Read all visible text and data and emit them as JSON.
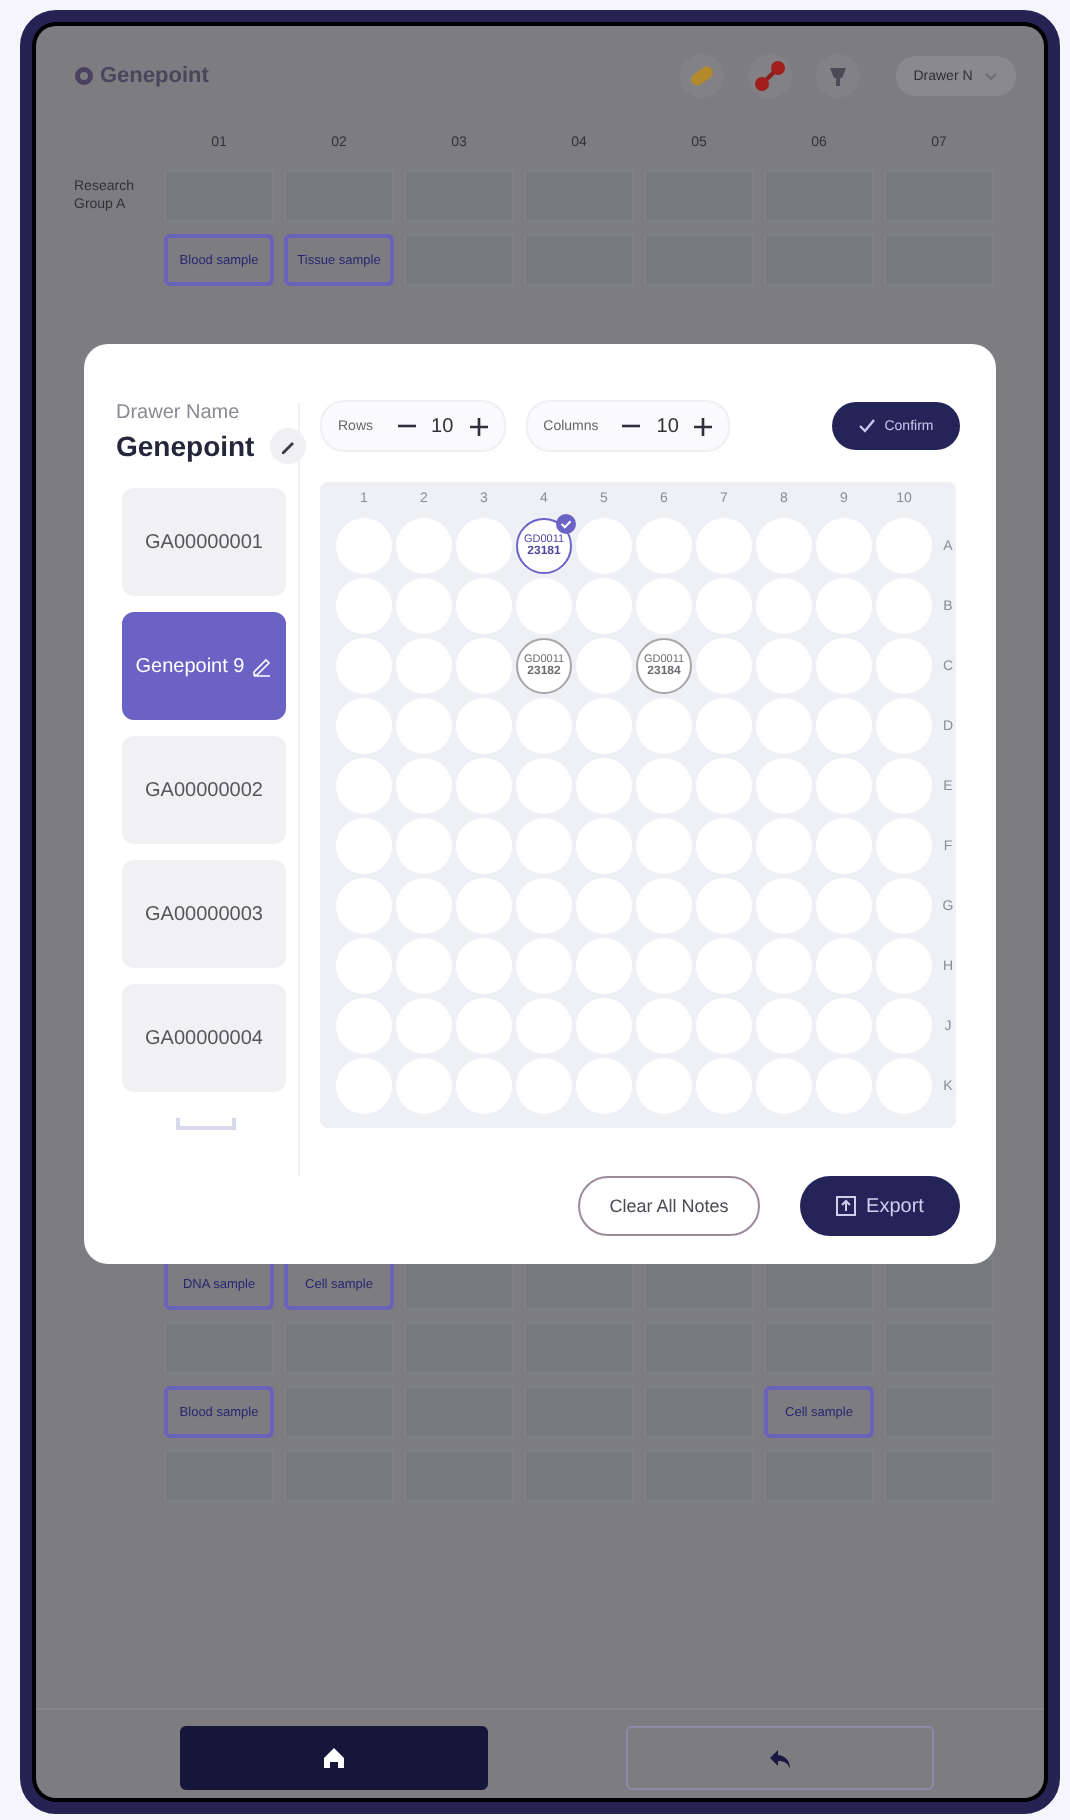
{
  "app": {
    "title": "Genepoint",
    "drawer_select": "Drawer N"
  },
  "board": {
    "columns": [
      "01",
      "02",
      "03",
      "04",
      "05",
      "06",
      "07"
    ],
    "top_rows": [
      {
        "label": "Research Group A",
        "cells": [
          {
            "kind": "empty"
          },
          {
            "kind": "empty"
          },
          {
            "kind": "empty"
          },
          {
            "kind": "empty"
          },
          {
            "kind": "empty"
          },
          {
            "kind": "empty"
          },
          {
            "kind": "empty"
          }
        ]
      },
      {
        "cells": [
          {
            "kind": "tag",
            "text": "Blood sample"
          },
          {
            "kind": "tag",
            "text": "Tissue sample"
          },
          {
            "kind": "empty"
          },
          {
            "kind": "empty"
          },
          {
            "kind": "empty"
          },
          {
            "kind": "empty"
          },
          {
            "kind": "empty"
          }
        ]
      }
    ],
    "bottom_rows": [
      {
        "cells": [
          {
            "kind": "tag",
            "text": "DNA sample"
          },
          {
            "kind": "tag",
            "text": "Cell sample"
          },
          {
            "kind": "empty"
          },
          {
            "kind": "empty"
          },
          {
            "kind": "empty"
          },
          {
            "kind": "empty"
          },
          {
            "kind": "empty"
          }
        ]
      },
      {
        "cells": [
          {
            "kind": "empty"
          },
          {
            "kind": "empty"
          },
          {
            "kind": "empty"
          },
          {
            "kind": "empty"
          },
          {
            "kind": "empty"
          },
          {
            "kind": "empty"
          },
          {
            "kind": "empty"
          }
        ]
      },
      {
        "cells": [
          {
            "kind": "tag",
            "text": "Blood sample"
          },
          {
            "kind": "empty"
          },
          {
            "kind": "empty"
          },
          {
            "kind": "empty"
          },
          {
            "kind": "empty"
          },
          {
            "kind": "tag",
            "text": "Cell sample"
          },
          {
            "kind": "empty"
          }
        ]
      },
      {
        "cells": [
          {
            "kind": "empty"
          },
          {
            "kind": "empty"
          },
          {
            "kind": "empty"
          },
          {
            "kind": "empty"
          },
          {
            "kind": "empty"
          },
          {
            "kind": "empty"
          },
          {
            "kind": "empty"
          }
        ]
      }
    ]
  },
  "dialog": {
    "name_label": "Drawer Name",
    "name": "Genepoint",
    "drawers": [
      {
        "label": "GA00000001",
        "selected": false
      },
      {
        "label": "Genepoint 9",
        "selected": true
      },
      {
        "label": "GA00000002",
        "selected": false
      },
      {
        "label": "GA00000003",
        "selected": false
      },
      {
        "label": "GA00000004",
        "selected": false
      }
    ],
    "rows": {
      "label": "Rows",
      "value": "10"
    },
    "columns": {
      "label": "Columns",
      "value": "10"
    },
    "confirm": "Confirm",
    "column_numbers": [
      "1",
      "2",
      "3",
      "4",
      "5",
      "6",
      "7",
      "8",
      "9",
      "10"
    ],
    "wells": [
      {
        "letter": "A",
        "wells": [
          {
            "kind": "empty"
          },
          {
            "kind": "empty"
          },
          {
            "kind": "empty"
          },
          {
            "kind": "tube",
            "line1": "GD0011",
            "line2": "23181",
            "checked": true
          },
          {
            "kind": "empty"
          },
          {
            "kind": "empty"
          },
          {
            "kind": "empty"
          },
          {
            "kind": "empty"
          },
          {
            "kind": "empty"
          },
          {
            "kind": "empty"
          }
        ]
      },
      {
        "letter": "B",
        "wells": [
          {
            "kind": "empty"
          },
          {
            "kind": "empty"
          },
          {
            "kind": "empty"
          },
          {
            "kind": "empty"
          },
          {
            "kind": "empty"
          },
          {
            "kind": "empty"
          },
          {
            "kind": "empty"
          },
          {
            "kind": "empty"
          },
          {
            "kind": "empty"
          },
          {
            "kind": "empty"
          }
        ]
      },
      {
        "letter": "C",
        "wells": [
          {
            "kind": "empty"
          },
          {
            "kind": "empty"
          },
          {
            "kind": "empty"
          },
          {
            "kind": "tube",
            "line1": "GD0011",
            "line2": "23182",
            "checked": false
          },
          {
            "kind": "empty"
          },
          {
            "kind": "tube",
            "line1": "GD0011",
            "line2": "23184",
            "checked": false
          },
          {
            "kind": "empty"
          },
          {
            "kind": "empty"
          },
          {
            "kind": "empty"
          },
          {
            "kind": "empty"
          }
        ]
      },
      {
        "letter": "D",
        "wells": [
          {
            "kind": "empty"
          },
          {
            "kind": "empty"
          },
          {
            "kind": "empty"
          },
          {
            "kind": "empty"
          },
          {
            "kind": "empty"
          },
          {
            "kind": "empty"
          },
          {
            "kind": "empty"
          },
          {
            "kind": "empty"
          },
          {
            "kind": "empty"
          },
          {
            "kind": "empty"
          }
        ]
      },
      {
        "letter": "E",
        "wells": [
          {
            "kind": "empty"
          },
          {
            "kind": "empty"
          },
          {
            "kind": "empty"
          },
          {
            "kind": "empty"
          },
          {
            "kind": "empty"
          },
          {
            "kind": "empty"
          },
          {
            "kind": "empty"
          },
          {
            "kind": "empty"
          },
          {
            "kind": "empty"
          },
          {
            "kind": "empty"
          }
        ]
      },
      {
        "letter": "F",
        "wells": [
          {
            "kind": "empty"
          },
          {
            "kind": "empty"
          },
          {
            "kind": "empty"
          },
          {
            "kind": "empty"
          },
          {
            "kind": "empty"
          },
          {
            "kind": "empty"
          },
          {
            "kind": "empty"
          },
          {
            "kind": "empty"
          },
          {
            "kind": "empty"
          },
          {
            "kind": "empty"
          }
        ]
      },
      {
        "letter": "G",
        "wells": [
          {
            "kind": "empty"
          },
          {
            "kind": "empty"
          },
          {
            "kind": "empty"
          },
          {
            "kind": "empty"
          },
          {
            "kind": "empty"
          },
          {
            "kind": "empty"
          },
          {
            "kind": "empty"
          },
          {
            "kind": "empty"
          },
          {
            "kind": "empty"
          },
          {
            "kind": "empty"
          }
        ]
      },
      {
        "letter": "H",
        "wells": [
          {
            "kind": "empty"
          },
          {
            "kind": "empty"
          },
          {
            "kind": "empty"
          },
          {
            "kind": "empty"
          },
          {
            "kind": "empty"
          },
          {
            "kind": "empty"
          },
          {
            "kind": "empty"
          },
          {
            "kind": "empty"
          },
          {
            "kind": "empty"
          },
          {
            "kind": "empty"
          }
        ]
      },
      {
        "letter": "J",
        "wells": [
          {
            "kind": "empty"
          },
          {
            "kind": "empty"
          },
          {
            "kind": "empty"
          },
          {
            "kind": "empty"
          },
          {
            "kind": "empty"
          },
          {
            "kind": "empty"
          },
          {
            "kind": "empty"
          },
          {
            "kind": "empty"
          },
          {
            "kind": "empty"
          },
          {
            "kind": "empty"
          }
        ]
      },
      {
        "letter": "K",
        "wells": [
          {
            "kind": "empty"
          },
          {
            "kind": "empty"
          },
          {
            "kind": "empty"
          },
          {
            "kind": "empty"
          },
          {
            "kind": "empty"
          },
          {
            "kind": "empty"
          },
          {
            "kind": "empty"
          },
          {
            "kind": "empty"
          },
          {
            "kind": "empty"
          },
          {
            "kind": "empty"
          }
        ]
      }
    ],
    "clear_button": "Clear All Notes",
    "export_button": "Export"
  },
  "nav": [
    {
      "kind": "home",
      "selected": true
    },
    {
      "kind": "back",
      "selected": false
    }
  ]
}
